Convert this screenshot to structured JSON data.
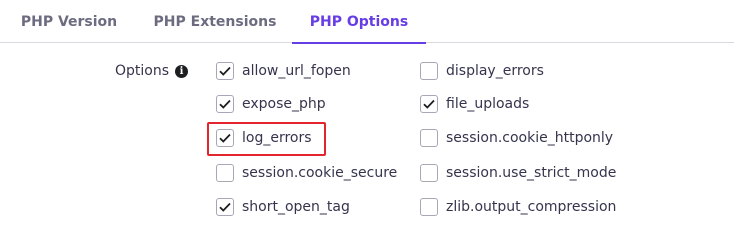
{
  "tabs": [
    {
      "label": "PHP Version",
      "active": false
    },
    {
      "label": "PHP Extensions",
      "active": false
    },
    {
      "label": "PHP Options",
      "active": true
    }
  ],
  "options_section": {
    "label": "Options",
    "info_icon": "info-icon"
  },
  "options": {
    "col1": [
      {
        "name": "allow_url_fopen",
        "checked": true
      },
      {
        "name": "expose_php",
        "checked": true
      },
      {
        "name": "log_errors",
        "checked": true,
        "highlighted": true
      },
      {
        "name": "session.cookie_secure",
        "checked": false
      },
      {
        "name": "short_open_tag",
        "checked": true
      }
    ],
    "col2": [
      {
        "name": "display_errors",
        "checked": false
      },
      {
        "name": "file_uploads",
        "checked": true
      },
      {
        "name": "session.cookie_httponly",
        "checked": false
      },
      {
        "name": "session.use_strict_mode",
        "checked": false
      },
      {
        "name": "zlib.output_compression",
        "checked": false
      }
    ]
  },
  "colors": {
    "accent": "#673de6",
    "highlight": "#e4252e"
  }
}
